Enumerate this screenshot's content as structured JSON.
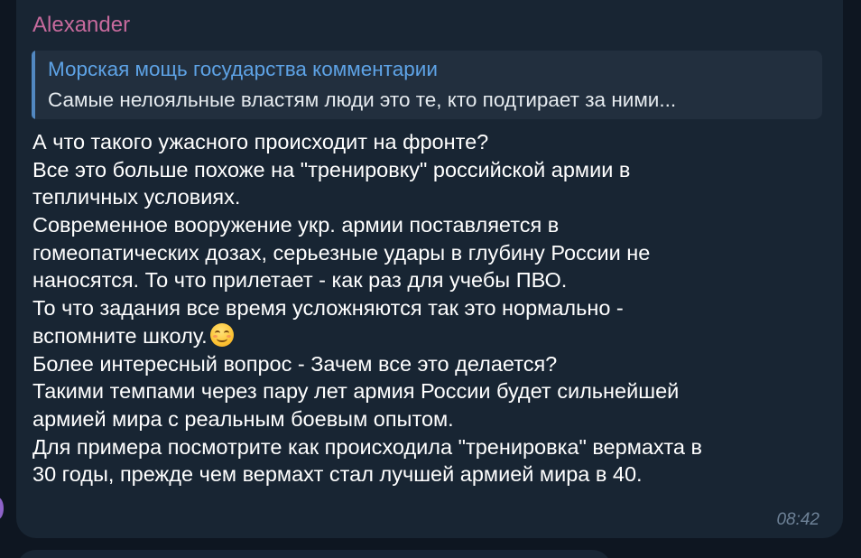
{
  "message": {
    "sender": "Alexander",
    "reply": {
      "title": "Морская мощь государства комментарии",
      "text": "Самые нелояльные властям люди это те, кто подтирает за ними..."
    },
    "lines": [
      "А что такого ужасного происходит на фронте?",
      "Все это больше похоже на \"тренировку\" российской армии в",
      "тепличных условиях.",
      "Современное вооружение укр. армии поставляется  в",
      "гомеопатических дозах, серьезные удары в глубину России не",
      "наносятся. То что прилетает - как раз для учебы ПВО.",
      "То что задания все время усложняются так это нормально -",
      "вспомните школу.",
      "Более интересный вопрос - Зачем все это делается?",
      "Такими темпами через пару лет армия России будет сильнейшей",
      "армией мира с реальным боевым опытом.",
      "Для примера посмотрите как происходила \"тренировка\" вермахта в",
      "30 годы, прежде чем вермахт стал лучшей армией мира в 40."
    ],
    "emoji_icon": "smiling-face-with-smiling-eyes-icon",
    "time": "08:42"
  },
  "colors": {
    "background": "#0e1621",
    "bubble": "#182533",
    "sender": "#c76a9d",
    "reply_accent": "#5288c1",
    "reply_title": "#5ea3e6",
    "text": "#ffffff",
    "time": "#6d8196"
  }
}
